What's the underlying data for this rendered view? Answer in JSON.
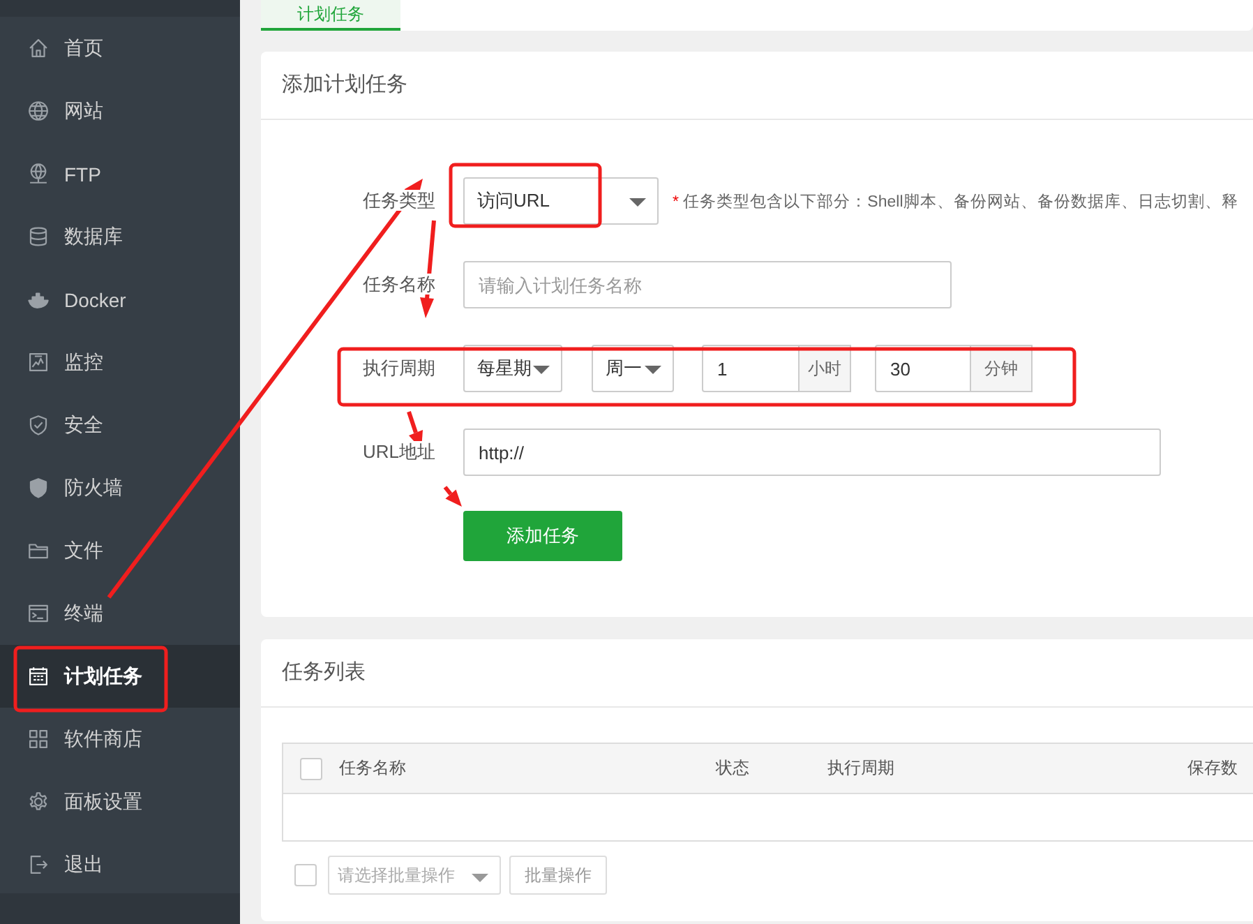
{
  "sidebar": {
    "items": [
      {
        "label": "首页",
        "selected": false
      },
      {
        "label": "网站",
        "selected": false
      },
      {
        "label": "FTP",
        "selected": false
      },
      {
        "label": "数据库",
        "selected": false
      },
      {
        "label": "Docker",
        "selected": false
      },
      {
        "label": "监控",
        "selected": false
      },
      {
        "label": "安全",
        "selected": false
      },
      {
        "label": "防火墙",
        "selected": false
      },
      {
        "label": "文件",
        "selected": false
      },
      {
        "label": "终端",
        "selected": false
      },
      {
        "label": "计划任务",
        "selected": true
      },
      {
        "label": "软件商店",
        "selected": false
      },
      {
        "label": "面板设置",
        "selected": false
      },
      {
        "label": "退出",
        "selected": false
      }
    ]
  },
  "tabs": [
    {
      "label": "计划任务",
      "selected": true
    }
  ],
  "add_task": {
    "title": "添加计划任务",
    "task_type": {
      "label": "任务类型",
      "value": "访问URL",
      "hint_mark": "*",
      "hint": "任务类型包含以下部分：Shell脚本、备份网站、备份数据库、日志切割、释"
    },
    "task_name": {
      "label": "任务名称",
      "placeholder": "请输入计划任务名称"
    },
    "period": {
      "label": "执行周期",
      "cycle": "每星期",
      "weekday": "周一",
      "hour": "1",
      "hour_unit": "小时",
      "minute": "30",
      "minute_unit": "分钟"
    },
    "url": {
      "label": "URL地址",
      "value": "http://"
    },
    "submit": "添加任务"
  },
  "task_list": {
    "title": "任务列表",
    "select_all": {
      "checked": false
    },
    "columns": [
      "任务名称",
      "状态",
      "执行周期",
      "保存数"
    ],
    "batch": {
      "checked": false,
      "placeholder": "请选择批量操作",
      "button": "批量操作"
    }
  }
}
